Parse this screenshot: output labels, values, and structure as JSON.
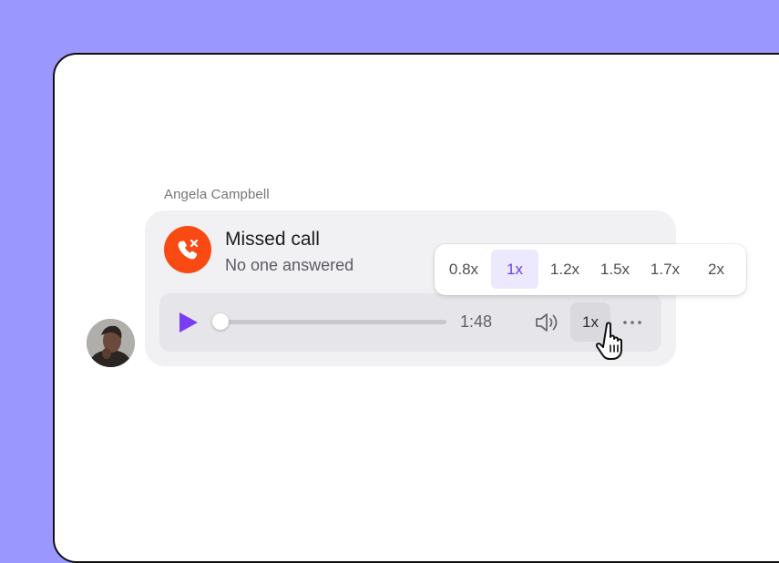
{
  "message": {
    "sender": "Angela Campbell",
    "title": "Missed call",
    "subtitle": "No one answered"
  },
  "player": {
    "duration": "1:48",
    "progress": 0.0,
    "speed_button_label": "1x"
  },
  "speed_menu": {
    "options": [
      "0.8x",
      "1x",
      "1.2x",
      "1.5x",
      "1.7x",
      "2x"
    ],
    "selected": "1x"
  },
  "colors": {
    "background": "#9a98ff",
    "call_icon": "#fa4a14",
    "accent": "#6b3cf0",
    "selected_option_bg": "#ece9fe"
  },
  "icons": {
    "call": "phone-missed-icon",
    "play": "play-icon",
    "volume": "speaker-icon",
    "more": "more-horizontal-icon",
    "pointer": "hand-pointer-cursor-icon"
  }
}
